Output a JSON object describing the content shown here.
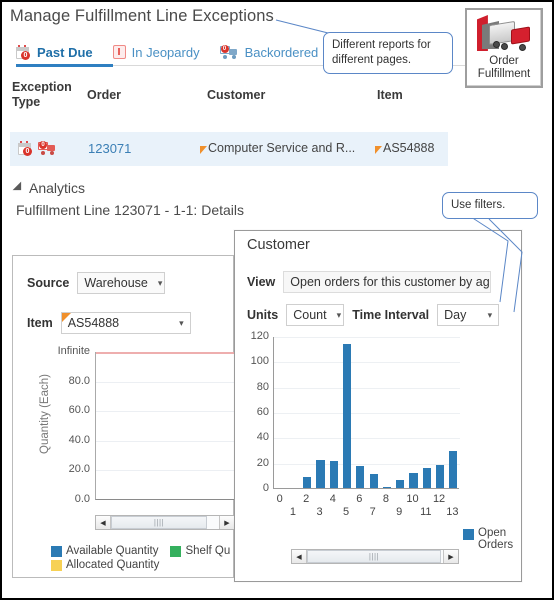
{
  "header": {
    "title": "Manage Fulfillment Line Exceptions"
  },
  "tabs": [
    {
      "label": "Past Due",
      "icon": "calendar-alert-icon",
      "badge": "0",
      "active": true
    },
    {
      "label": "In Jeopardy",
      "icon": "jeopardy-icon",
      "active": false
    },
    {
      "label": "Backordered",
      "icon": "backorder-truck-icon",
      "badge": "0",
      "active": false
    }
  ],
  "table": {
    "columns": [
      "Exception Type",
      "Order",
      "Customer",
      "Item"
    ],
    "column_exception_line1": "Exception",
    "column_exception_line2": "Type",
    "rows": [
      {
        "icons": [
          "calendar-alert-icon",
          "backorder-truck-icon"
        ],
        "order": "123071",
        "customer": "Computer Service and R...",
        "item": "AS54888"
      }
    ]
  },
  "analytics": {
    "section_label": "Analytics",
    "detail_label": "Fulfillment Line 123071 - 1-1: Details"
  },
  "left_panel": {
    "source_label": "Source",
    "source_value": "Warehouse",
    "item_label": "Item",
    "item_value": "AS54888",
    "legend": [
      {
        "label": "Available Quantity",
        "color": "#2b7ab4"
      },
      {
        "label": "Shelf Qu",
        "color": "#35b05e"
      },
      {
        "label": "Allocated Quantity",
        "color": "#f7d154"
      }
    ]
  },
  "customer_panel": {
    "title": "Customer",
    "view_label": "View",
    "view_value": "Open orders for this customer by age",
    "units_label": "Units",
    "units_value": "Count",
    "interval_label": "Time Interval",
    "interval_value": "Day"
  },
  "order_fulfillment": {
    "line1": "Order",
    "line2": "Fulfillment",
    "icon": "truck-dock-icon"
  },
  "callouts": [
    {
      "name": "reports-callout",
      "text": "Different reports for different pages."
    },
    {
      "name": "filters-callout",
      "text": "Use filters."
    }
  ],
  "icons": {
    "caret_down": "▾",
    "scroll_left": "◀",
    "scroll_right": "▶",
    "grip": "‖‖"
  },
  "chart_data": [
    {
      "name": "left-inventory-chart",
      "type": "bar",
      "title": "",
      "xlabel": "",
      "ylabel": "Quantity (Each)",
      "ylim": [
        0,
        100
      ],
      "ytick_labels": [
        "Infinite",
        "80.0",
        "60.0",
        "40.0",
        "20.0",
        "0.0"
      ],
      "ytick_values": [
        100,
        80,
        60,
        40,
        20,
        0
      ],
      "grid": true,
      "legend_position": "bottom",
      "categories": [],
      "series": [
        {
          "name": "Available Quantity",
          "color": "#2b7ab4",
          "values": []
        },
        {
          "name": "Shelf Qu",
          "color": "#35b05e",
          "values": []
        },
        {
          "name": "Allocated Quantity",
          "color": "#f7d154",
          "values": []
        }
      ],
      "annotations": [
        "Infinite limit line shown at top of plot (pink)"
      ]
    },
    {
      "name": "customer-open-orders-chart",
      "type": "bar",
      "title": "Open orders for this customer by age",
      "xlabel": "",
      "ylabel": "",
      "ylim": [
        0,
        120
      ],
      "ytick_labels": [
        "0",
        "20",
        "40",
        "60",
        "80",
        "100",
        "120"
      ],
      "ytick_values": [
        0,
        20,
        40,
        60,
        80,
        100,
        120
      ],
      "grid": true,
      "legend_position": "right",
      "categories": [
        "0",
        "1",
        "2",
        "3",
        "4",
        "5",
        "6",
        "7",
        "8",
        "9",
        "10",
        "11",
        "12",
        "13"
      ],
      "series": [
        {
          "name": "Open Orders",
          "color": "#2b7ab4",
          "values": [
            0,
            0,
            9,
            22,
            21,
            114,
            17,
            11,
            1,
            6,
            12,
            16,
            18,
            29
          ]
        }
      ]
    }
  ]
}
